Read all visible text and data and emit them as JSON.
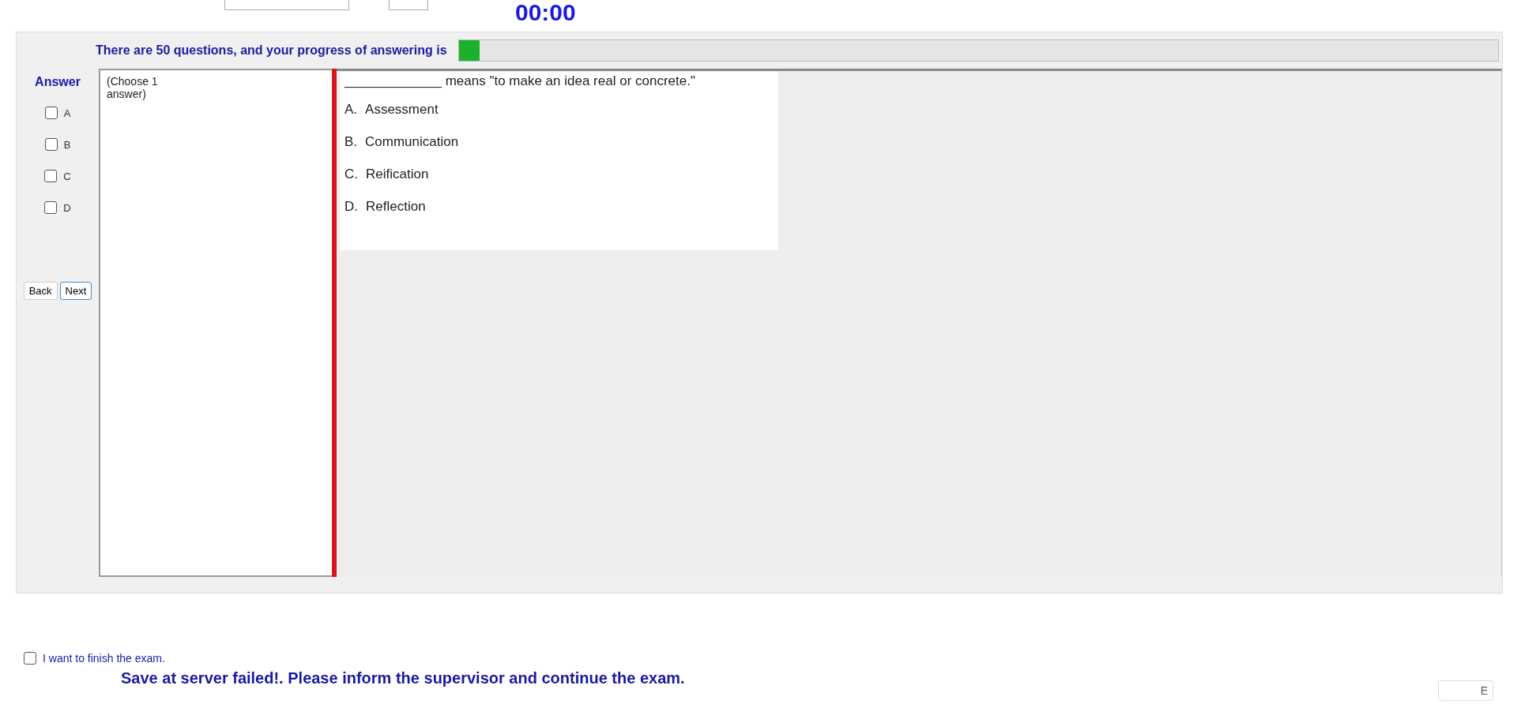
{
  "timer": "00:00",
  "progress": {
    "label": "There are 50 questions, and your progress of answering is",
    "level": 0.02
  },
  "answer": {
    "title": "Answer",
    "options": [
      {
        "label": "A",
        "checked": false
      },
      {
        "label": "B",
        "checked": false
      },
      {
        "label": "C",
        "checked": false
      },
      {
        "label": "D",
        "checked": false
      }
    ]
  },
  "navigation": [
    "Back",
    "Next"
  ],
  "instruction": "(Choose 1 answer)",
  "question": {
    "stem": "_____________ means \"to make an idea real or concrete.\"",
    "choices": [
      {
        "letter": "A.",
        "text": "Assessment"
      },
      {
        "letter": "B.",
        "text": "Communication"
      },
      {
        "letter": "C.",
        "text": "Reification"
      },
      {
        "letter": "D.",
        "text": "Reflection"
      }
    ]
  },
  "finish": {
    "label": "I want to finish the exam.",
    "checked": false
  },
  "status_message": "Save at server failed!. Please inform the supervisor and continue the exam.",
  "exit_button": "E"
}
